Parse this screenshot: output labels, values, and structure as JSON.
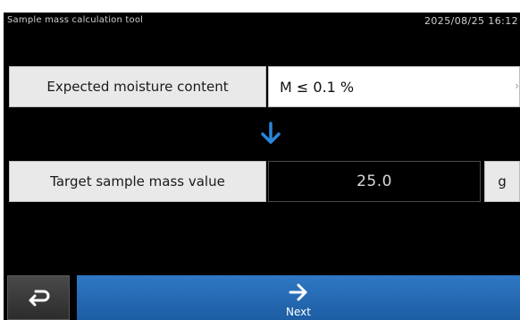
{
  "status_bar": {
    "title": "Sample mass calculation tool",
    "datetime": "2025/08/25 16:12"
  },
  "moisture": {
    "label": "Expected moisture content",
    "value": "M ≤ 0.1 %"
  },
  "target": {
    "label": "Target sample mass value",
    "value": "25.0",
    "unit": "g"
  },
  "footer": {
    "next_label": "Next",
    "back_icon": "return-arrow-icon",
    "next_icon": "right-arrow-icon"
  },
  "colors": {
    "accent_blue": "#1d6fc4",
    "down_arrow": "#2a86d8"
  }
}
